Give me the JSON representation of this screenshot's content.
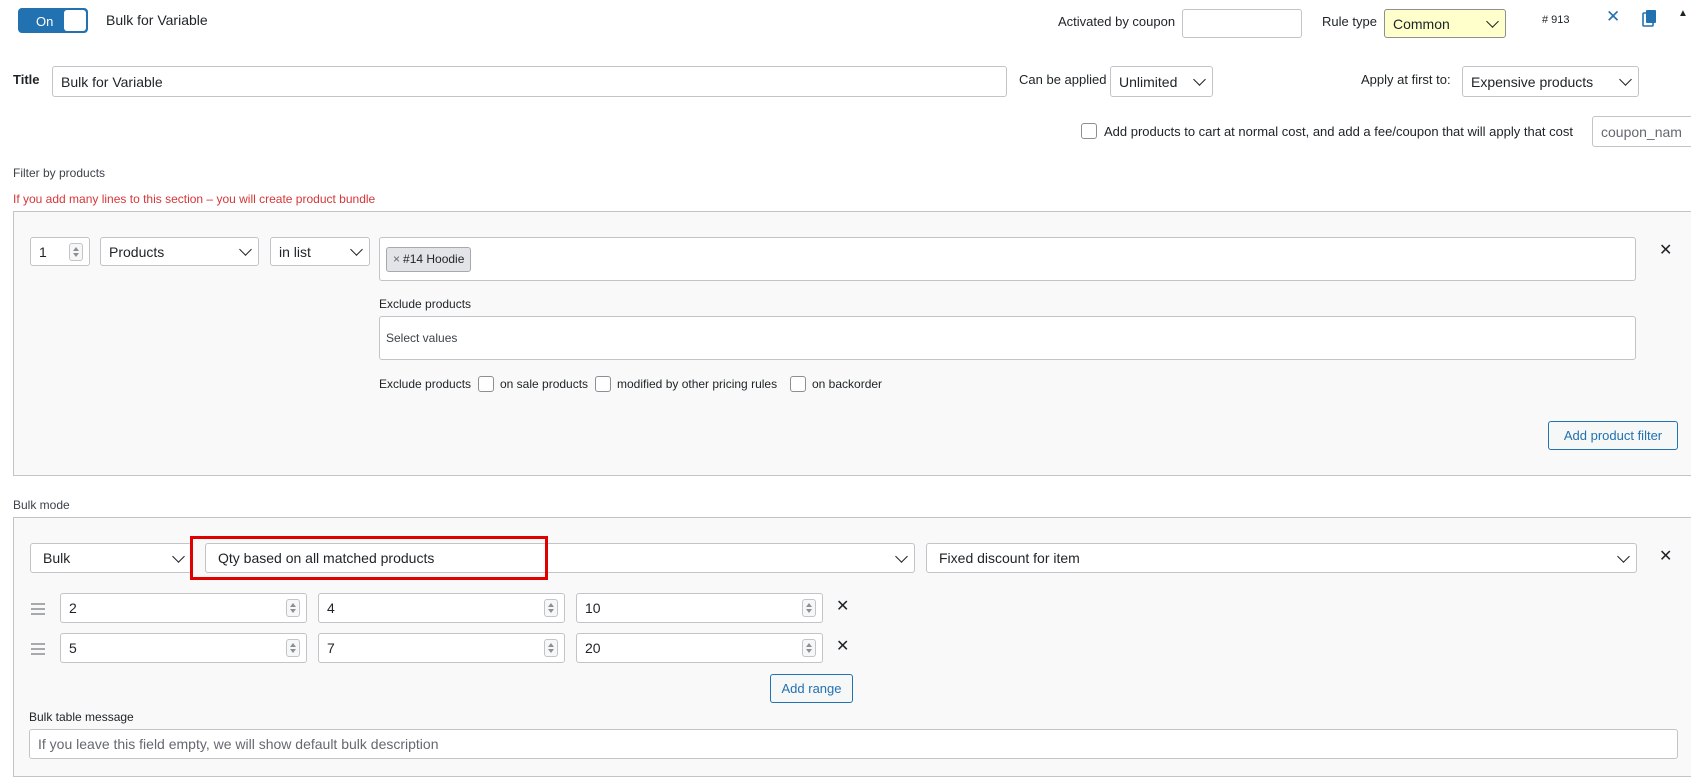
{
  "header": {
    "toggle_label": "On",
    "rule_name": "Bulk for Variable",
    "activated_by_coupon_label": "Activated by coupon",
    "activated_by_coupon_value": "",
    "rule_type_label": "Rule type",
    "rule_type_value": "Common",
    "rule_id": "# 913",
    "close_glyph": "✕",
    "copy_icon": "copy-icon",
    "collapse_glyph": "▲"
  },
  "title_row": {
    "title_label": "Title",
    "title_value": "Bulk for Variable",
    "can_be_applied_label": "Can be applied",
    "can_be_applied_value": "Unlimited",
    "apply_first_label": "Apply at first to:",
    "apply_first_value": "Expensive products"
  },
  "fee_row": {
    "checkbox_label": "Add products to cart at normal cost, and add a fee/coupon that will apply that cost",
    "coupon_placeholder": "coupon_nam"
  },
  "filter": {
    "section_label": "Filter by products",
    "warning": "If you add many lines to this section – you will create product bundle",
    "qty_value": "1",
    "type_value": "Products",
    "method_value": "in list",
    "tag_remove": "×",
    "tag_label": "#14 Hoodie",
    "exclude_label": "Exclude products",
    "exclude_placeholder": "Select values",
    "exclude_options_label": "Exclude products",
    "opt_on_sale": "on sale products",
    "opt_modified": "modified by other pricing rules",
    "opt_backorder": "on backorder",
    "remove_glyph": "✕",
    "add_button": "Add product filter"
  },
  "bulk": {
    "section_label": "Bulk mode",
    "mode_value": "Bulk",
    "qty_basis_value": "Qty based on all matched products",
    "discount_type_value": "Fixed discount for item",
    "remove_glyph": "✕",
    "ranges": [
      {
        "from": "2",
        "to": "4",
        "value": "10"
      },
      {
        "from": "5",
        "to": "7",
        "value": "20"
      }
    ],
    "add_range_button": "Add range",
    "message_label": "Bulk table message",
    "message_placeholder": "If you leave this field empty, we will show default bulk description"
  },
  "colors": {
    "accent": "#2271b1",
    "highlight": "#e00000",
    "warning_text": "#d63638",
    "rule_type_bg": "#ffffcc"
  }
}
